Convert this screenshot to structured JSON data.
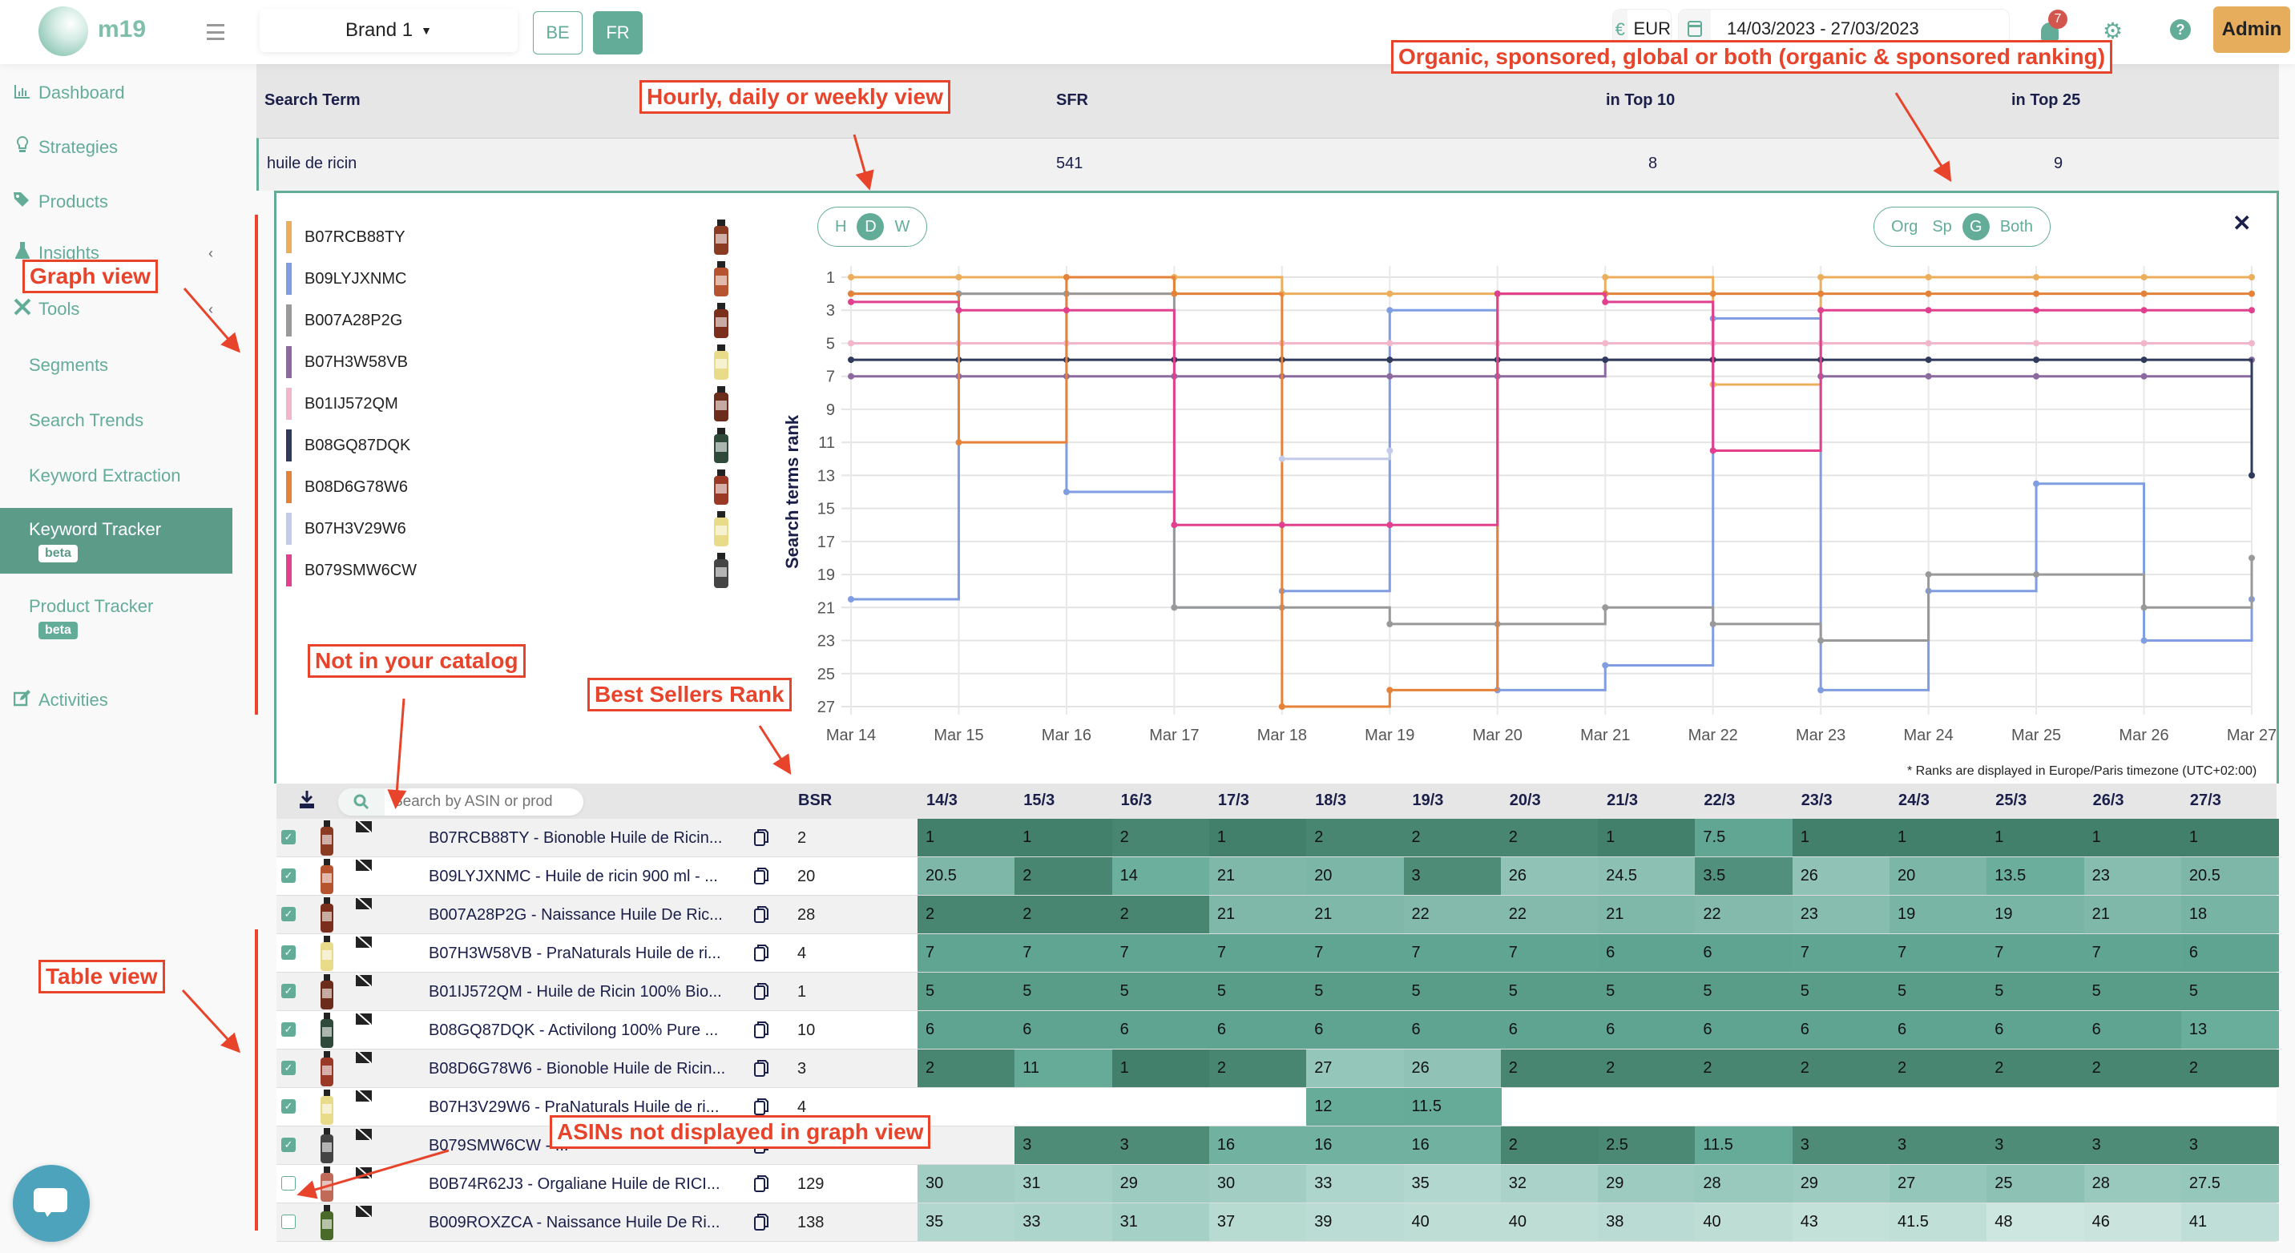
{
  "topbar": {
    "logo_text": "m19",
    "brand_selected": "Brand 1",
    "marketplaces": [
      {
        "label": "BE",
        "active": false
      },
      {
        "label": "FR",
        "active": true
      }
    ],
    "currency_symbol": "€",
    "currency": "EUR",
    "date_range": "14/03/2023 - 27/03/2023",
    "notification_count": "7",
    "admin_label": "Admin"
  },
  "sidebar": {
    "items": [
      {
        "label": "Dashboard",
        "icon": "bar-chart-icon"
      },
      {
        "label": "Strategies",
        "icon": "lightbulb-icon"
      },
      {
        "label": "Products",
        "icon": "tags-icon"
      },
      {
        "label": "Insights",
        "icon": "flask-icon"
      },
      {
        "label": "Tools",
        "icon": "tools-icon"
      },
      {
        "label": "Segments"
      },
      {
        "label": "Search Trends"
      },
      {
        "label": "Keyword Extraction"
      },
      {
        "label": "Keyword Tracker",
        "badge": "beta",
        "active": true
      },
      {
        "label": "Product Tracker",
        "badge": "beta"
      },
      {
        "label": "Activities",
        "icon": "edit-icon"
      }
    ]
  },
  "summary": {
    "headers": {
      "search_term": "Search Term",
      "sfr": "SFR",
      "top10": "in Top 10",
      "top25": "in Top 25"
    },
    "row": {
      "search_term": "huile de ricin",
      "sfr": "541",
      "top10": "8",
      "top25": "9"
    }
  },
  "graph": {
    "granularity_options": [
      "H",
      "D",
      "W"
    ],
    "granularity_selected": "D",
    "ranking_options": [
      "Org",
      "Sp",
      "G",
      "Both"
    ],
    "ranking_selected": "G",
    "timezone_note": "* Ranks are displayed in Europe/Paris timezone (UTC+02:00)"
  },
  "chart_data": {
    "type": "line",
    "step": true,
    "ylabel": "Search terms rank",
    "xlabel": "",
    "y_inverted": true,
    "ylim": [
      1,
      27
    ],
    "yticks": [
      1,
      3,
      5,
      7,
      9,
      11,
      13,
      15,
      17,
      19,
      21,
      23,
      25,
      27
    ],
    "x": [
      "Mar 14",
      "Mar 15",
      "Mar 16",
      "Mar 17",
      "Mar 18",
      "Mar 19",
      "Mar 20",
      "Mar 21",
      "Mar 22",
      "Mar 23",
      "Mar 24",
      "Mar 25",
      "Mar 26",
      "Mar 27"
    ],
    "grid": true,
    "legend": "left",
    "series": [
      {
        "name": "B07RCB88TY",
        "color": "#ecae5a",
        "values": [
          1,
          1,
          2,
          1,
          2,
          2,
          2,
          1,
          7.5,
          1,
          1,
          1,
          1,
          1
        ]
      },
      {
        "name": "B09LYJXNMC",
        "color": "#7f9de0",
        "values": [
          20.5,
          2,
          14,
          21,
          20,
          3,
          26,
          24.5,
          3.5,
          26,
          20,
          13.5,
          23,
          20.5
        ]
      },
      {
        "name": "B007A28P2G",
        "color": "#999999",
        "values": [
          2,
          2,
          2,
          21,
          21,
          22,
          22,
          21,
          22,
          23,
          19,
          19,
          21,
          18
        ]
      },
      {
        "name": "B07H3W58VB",
        "color": "#8c6aa0",
        "values": [
          7,
          7,
          7,
          7,
          7,
          7,
          7,
          6,
          6,
          7,
          7,
          7,
          7,
          6
        ]
      },
      {
        "name": "B01IJ572QM",
        "color": "#f2b6cb",
        "values": [
          5,
          5,
          5,
          5,
          5,
          5,
          5,
          5,
          5,
          5,
          5,
          5,
          5,
          5
        ]
      },
      {
        "name": "B08GQ87DQK",
        "color": "#2f3a5c",
        "values": [
          6,
          6,
          6,
          6,
          6,
          6,
          6,
          6,
          6,
          6,
          6,
          6,
          6,
          13
        ]
      },
      {
        "name": "B08D6G78W6",
        "color": "#e5823a",
        "values": [
          2,
          11,
          1,
          2,
          27,
          26,
          2,
          2,
          2,
          2,
          2,
          2,
          2,
          2
        ]
      },
      {
        "name": "B07H3V29W6",
        "color": "#c3cbe8",
        "values": [
          null,
          null,
          null,
          null,
          12,
          11.5,
          null,
          null,
          null,
          null,
          null,
          null,
          null,
          null
        ]
      },
      {
        "name": "B079SMW6CW",
        "color": "#e0408e",
        "values": [
          2.5,
          3,
          3,
          16,
          16,
          16,
          2,
          2.5,
          11.5,
          3,
          3,
          3,
          3,
          3
        ]
      }
    ]
  },
  "table": {
    "search_placeholder": "Search by ASIN or prod",
    "bsr_header": "BSR",
    "date_headers": [
      "14/3",
      "15/3",
      "16/3",
      "17/3",
      "18/3",
      "19/3",
      "20/3",
      "21/3",
      "22/3",
      "23/3",
      "24/3",
      "25/3",
      "26/3",
      "27/3"
    ],
    "rows": [
      {
        "checked": true,
        "label": "B07RCB88TY - Bionoble Huile de Ricin...",
        "bsr": "2",
        "ranks": [
          "1",
          "1",
          "2",
          "1",
          "2",
          "2",
          "2",
          "1",
          "7.5",
          "1",
          "1",
          "1",
          "1",
          "1"
        ]
      },
      {
        "checked": true,
        "label": "B09LYJXNMC - Huile de ricin 900 ml - ...",
        "bsr": "20",
        "ranks": [
          "20.5",
          "2",
          "14",
          "21",
          "20",
          "3",
          "26",
          "24.5",
          "3.5",
          "26",
          "20",
          "13.5",
          "23",
          "20.5"
        ]
      },
      {
        "checked": true,
        "label": "B007A28P2G - Naissance Huile De Ric...",
        "bsr": "28",
        "ranks": [
          "2",
          "2",
          "2",
          "21",
          "21",
          "22",
          "22",
          "21",
          "22",
          "23",
          "19",
          "19",
          "21",
          "18"
        ]
      },
      {
        "checked": true,
        "label": "B07H3W58VB - PraNaturals Huile de ri...",
        "bsr": "4",
        "ranks": [
          "7",
          "7",
          "7",
          "7",
          "7",
          "7",
          "7",
          "6",
          "6",
          "7",
          "7",
          "7",
          "7",
          "6"
        ]
      },
      {
        "checked": true,
        "label": "B01IJ572QM - Huile de Ricin 100% Bio...",
        "bsr": "1",
        "ranks": [
          "5",
          "5",
          "5",
          "5",
          "5",
          "5",
          "5",
          "5",
          "5",
          "5",
          "5",
          "5",
          "5",
          "5"
        ]
      },
      {
        "checked": true,
        "label": "B08GQ87DQK - Activilong 100% Pure ...",
        "bsr": "10",
        "ranks": [
          "6",
          "6",
          "6",
          "6",
          "6",
          "6",
          "6",
          "6",
          "6",
          "6",
          "6",
          "6",
          "6",
          "13"
        ]
      },
      {
        "checked": true,
        "label": "B08D6G78W6 - Bionoble Huile de Ricin...",
        "bsr": "3",
        "ranks": [
          "2",
          "11",
          "1",
          "2",
          "27",
          "26",
          "2",
          "2",
          "2",
          "2",
          "2",
          "2",
          "2",
          "2"
        ]
      },
      {
        "checked": true,
        "label": "B07H3V29W6 - PraNaturals Huile de ri...",
        "bsr": "4",
        "ranks": [
          "",
          "",
          "",
          "",
          "12",
          "11.5",
          "",
          "",
          "",
          "",
          "",
          "",
          "",
          ""
        ]
      },
      {
        "checked": true,
        "label": "B079SMW6CW - ...",
        "bsr": "",
        "ranks": [
          "",
          "3",
          "3",
          "16",
          "16",
          "16",
          "2",
          "2.5",
          "11.5",
          "3",
          "3",
          "3",
          "3",
          "3"
        ]
      },
      {
        "checked": false,
        "label": "B0B74R62J3 - Orgaliane Huile de RICI...",
        "bsr": "129",
        "ranks": [
          "30",
          "31",
          "29",
          "30",
          "33",
          "35",
          "32",
          "29",
          "28",
          "29",
          "27",
          "25",
          "28",
          "27.5"
        ]
      },
      {
        "checked": false,
        "label": "B009ROXZCA - Naissance Huile De Ri...",
        "bsr": "138",
        "ranks": [
          "35",
          "33",
          "31",
          "37",
          "39",
          "40",
          "40",
          "38",
          "40",
          "43",
          "41.5",
          "48",
          "46",
          "41"
        ]
      }
    ]
  },
  "annotations": {
    "granularity": "Hourly, daily or weekly view",
    "ranking_type": "Organic, sponsored, global or both (organic & sponsored ranking)",
    "graph_view": "Graph view",
    "not_in_catalog": "Not in your catalog",
    "bsr": "Best Sellers Rank",
    "table_view": "Table view",
    "not_displayed": "ASINs not displayed in graph view"
  },
  "colors": {
    "accent": "#63ad98",
    "sidebar_active": "#5b9b88",
    "admin": "#e6ad5c",
    "annotation": "#e8432b"
  }
}
